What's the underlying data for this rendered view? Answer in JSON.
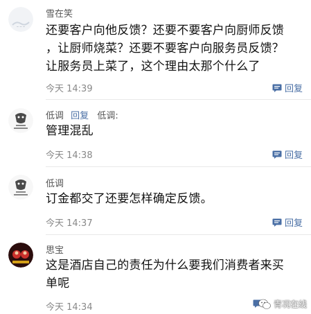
{
  "comments": [
    {
      "name": "雪在笑",
      "lines": [
        "还要客户向他反馈？还要不要客户向厨师反馈",
        "，让厨师烧菜？还要不要客户向服务员反馈？",
        "让服务员上菜了，这个理由太那个什么了"
      ],
      "time": "今天 14:39",
      "reply": "回复"
    },
    {
      "name": "低调",
      "reply_to_label": "回复",
      "reply_to_name": "低调:",
      "lines": [
        "管理混乱"
      ],
      "time": "今天 14:38",
      "reply": "回复"
    },
    {
      "name": "低调",
      "lines": [
        "订金都交了还要怎样确定反馈。"
      ],
      "time": "今天 14:37",
      "reply": "回复"
    },
    {
      "name": "思宝",
      "lines": [
        "这是酒店自己的责任为什么要我们消费者来买",
        "单呢"
      ],
      "time": "今天 14:34",
      "reply": "回复"
    }
  ],
  "watermark": {
    "text": "青况在线",
    "icon": "wechat-icon"
  }
}
